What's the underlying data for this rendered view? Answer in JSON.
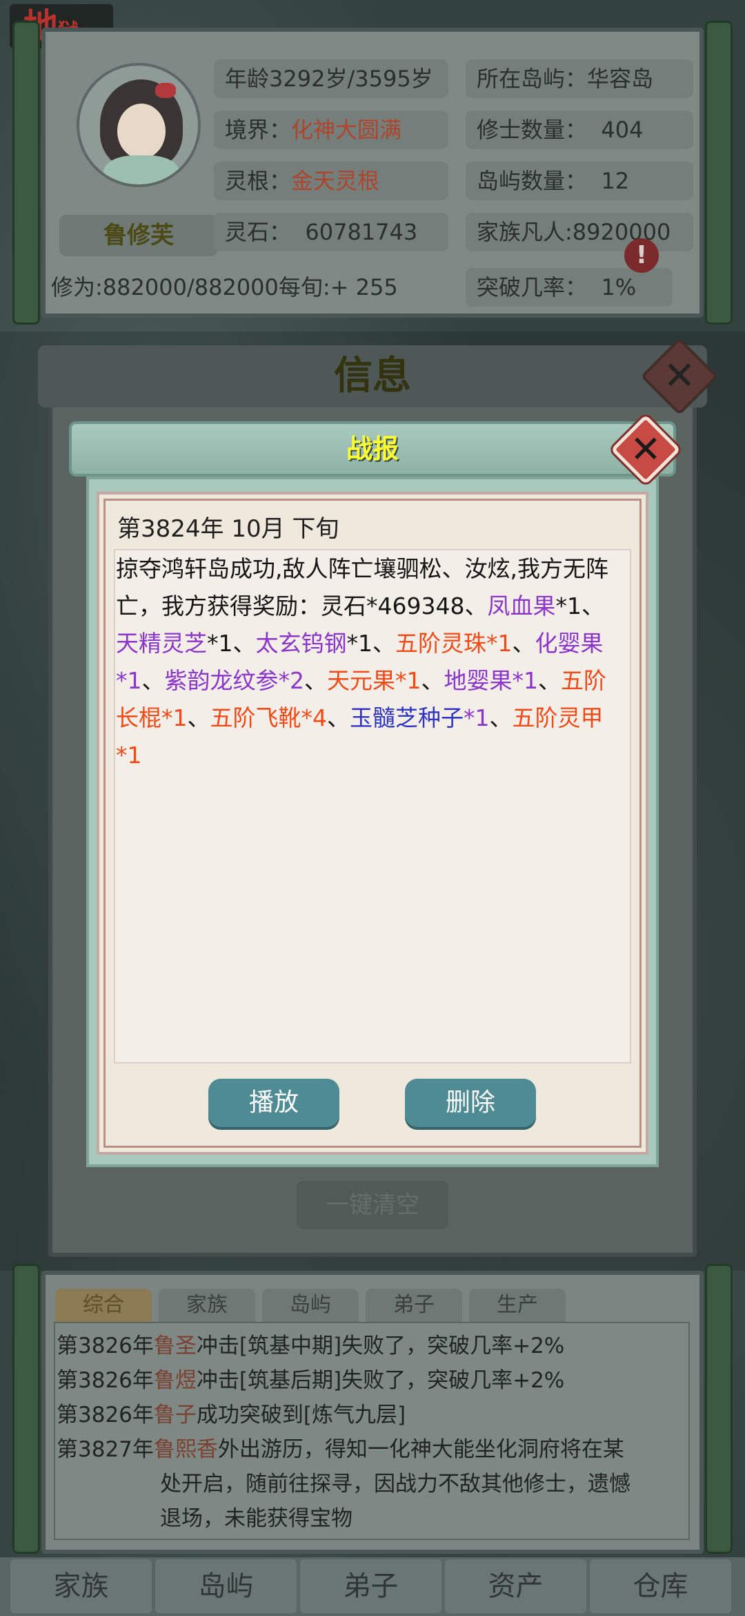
{
  "stamp": {
    "main": "地",
    "sub": "狱"
  },
  "player": {
    "name": "鲁修芙",
    "stats": [
      {
        "label": "年龄",
        "value": "3292岁/3595岁"
      },
      {
        "label": "境界：",
        "value": "化神大圆满"
      },
      {
        "label": "灵根：",
        "value": "金天灵根"
      },
      {
        "label": "灵石：",
        "value": "60781743"
      },
      {
        "label": "修为:",
        "value": "882000/882000"
      },
      {
        "label": "每旬:",
        "value": "+ 255"
      },
      {
        "label": "所在岛屿：",
        "value": "华容岛"
      },
      {
        "label": "修士数量：",
        "value": "404"
      },
      {
        "label": "岛屿数量：",
        "value": "12"
      },
      {
        "label": "家族凡人:",
        "value": "8920000"
      },
      {
        "label": "突破几率：",
        "value": "1%"
      }
    ],
    "alert": "!"
  },
  "info_panel": {
    "title": "信息",
    "close": "✕",
    "clear_all": "一键清空"
  },
  "modal": {
    "title": "战报",
    "close": "✕",
    "date": "第3824年 10月 下旬",
    "segments": [
      {
        "text": "掠夺鸿轩岛成功,敌人阵亡壤驷松、汝炫,我方无阵亡，我方获得奖励：灵石*469348、",
        "color": "black"
      },
      {
        "text": "凤血果",
        "color": "purple"
      },
      {
        "text": "*1、",
        "color": "black"
      },
      {
        "text": "天精灵芝",
        "color": "purple"
      },
      {
        "text": "*1、",
        "color": "black"
      },
      {
        "text": "太玄钨钢",
        "color": "purple"
      },
      {
        "text": "*1、",
        "color": "black"
      },
      {
        "text": "五阶灵珠*1",
        "color": "orange"
      },
      {
        "text": "、",
        "color": "black"
      },
      {
        "text": "化婴果*1",
        "color": "purple"
      },
      {
        "text": "、",
        "color": "black"
      },
      {
        "text": "紫韵龙纹参*2",
        "color": "purple"
      },
      {
        "text": "、",
        "color": "black"
      },
      {
        "text": "天元果*1",
        "color": "orange"
      },
      {
        "text": "、",
        "color": "black"
      },
      {
        "text": "地婴果*1",
        "color": "purple"
      },
      {
        "text": "、",
        "color": "black"
      },
      {
        "text": "五阶长棍*1",
        "color": "orange"
      },
      {
        "text": "、",
        "color": "black"
      },
      {
        "text": "五阶飞靴*4",
        "color": "orange"
      },
      {
        "text": "、",
        "color": "black"
      },
      {
        "text": "玉髓芝种子",
        "color": "blue"
      },
      {
        "text": "*1",
        "color": "purple"
      },
      {
        "text": "、",
        "color": "black"
      },
      {
        "text": "五阶灵甲*1",
        "color": "orange"
      }
    ],
    "buttons": {
      "play": "播放",
      "delete": "删除"
    }
  },
  "log": {
    "tabs": [
      "综合",
      "家族",
      "岛屿",
      "弟子",
      "生产"
    ],
    "entries": [
      {
        "year": "第3826年",
        "name": "鲁圣",
        "text": "冲击[筑基中期]失败了，突破几率+2%"
      },
      {
        "year": "第3826年",
        "name": "鲁煜",
        "text": "冲击[筑基后期]失败了，突破几率+2%"
      },
      {
        "year": "第3826年",
        "name": "鲁子",
        "text": "成功突破到[炼气九层]"
      },
      {
        "year": "第3827年",
        "name": "鲁熙香",
        "text": "外出游历，得知一化神大能坐化洞府将在某"
      }
    ],
    "continuation": [
      "处开启，随前往探寻，因战力不敌其他修士，遗憾",
      "退场，未能获得宝物"
    ]
  },
  "nav": [
    "家族",
    "岛屿",
    "弟子",
    "资产",
    "仓库"
  ]
}
